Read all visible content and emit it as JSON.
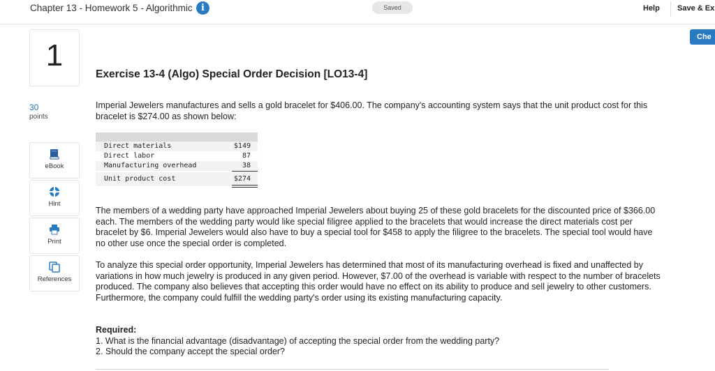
{
  "header": {
    "assignment_title": "Chapter 13 - Homework 5 - Algorithmic",
    "info_glyph": "i",
    "saved_status": "Saved",
    "help_label": "Help",
    "save_exit_label": "Save & Ex",
    "check_label": "Che"
  },
  "question": {
    "number": "1",
    "points_value": "30",
    "points_label": "points",
    "title": "Exercise 13-4 (Algo) Special Order Decision [LO13-4]"
  },
  "sidebar": {
    "items": [
      {
        "label": "eBook",
        "icon": "book-icon"
      },
      {
        "label": "Hint",
        "icon": "lifebuoy-icon"
      },
      {
        "label": "Print",
        "icon": "printer-icon"
      },
      {
        "label": "References",
        "icon": "documents-icon"
      }
    ]
  },
  "content": {
    "intro": "Imperial Jewelers manufactures and sells a gold bracelet for $406.00. The company's accounting system says that the unit product cost for this bracelet is $274.00 as shown below:",
    "cost_table": {
      "rows": [
        {
          "item": "Direct materials",
          "amount": "$149"
        },
        {
          "item": "Direct labor",
          "amount": "87"
        },
        {
          "item": "Manufacturing overhead",
          "amount": "38"
        }
      ],
      "total": {
        "item": "Unit product cost",
        "amount": "$274"
      }
    },
    "order_paragraph": "The members of a wedding party have approached Imperial Jewelers about buying 25 of these gold bracelets for the discounted price of $366.00 each. The members of the wedding party would like special filigree applied to the bracelets that would increase the direct materials cost per bracelet by $6. Imperial Jewelers would also have to buy a special tool for $458 to apply the filigree to the bracelets. The special tool would have no other use once the special order is completed.",
    "analysis_paragraph": "To analyze this special order opportunity, Imperial Jewelers has determined that most of its manufacturing overhead is fixed and unaffected by variations in how much jewelry is produced in any given period. However, $7.00 of the overhead is variable with respect to the number of bracelets produced. The company also believes that accepting this order would have no effect on its ability to produce and sell jewelry to other customers. Furthermore, the company could fulfill the wedding party's order using its existing manufacturing capacity.",
    "required_label": "Required:",
    "required_items": [
      "1. What is the financial advantage (disadvantage) of accepting the special order from the wedding party?",
      "2. Should the company accept the special order?"
    ]
  },
  "colors": {
    "accent": "#2a7ac2",
    "points": "#2a6ebb",
    "table_header": "#d9d9d9",
    "table_row": "#f2f2f2"
  }
}
